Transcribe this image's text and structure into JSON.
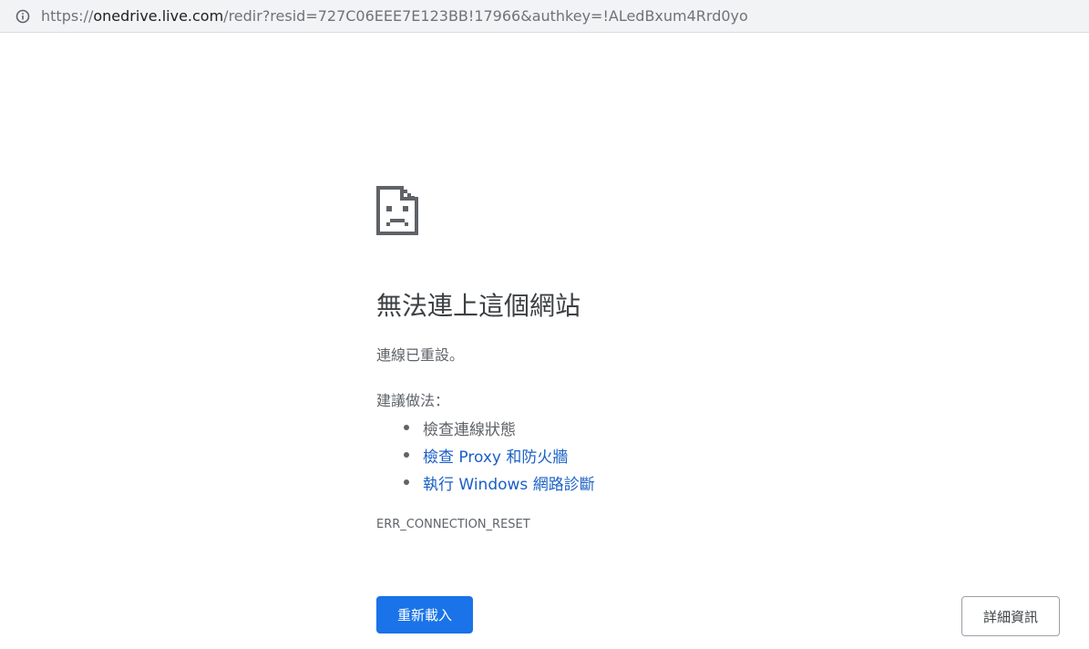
{
  "address_bar": {
    "url_scheme": "https://",
    "url_host": "onedrive.live.com",
    "url_rest": "/redir?resid=727C06EEE7E123BB!17966&authkey=!ALedBxum4Rrd0yo",
    "icon": "info-icon"
  },
  "error_page": {
    "icon": "sad-document-icon",
    "title": "無法連上這個網站",
    "subtitle": "連線已重設。",
    "suggestions_heading": "建議做法：",
    "suggestions": [
      {
        "text": "檢查連線狀態",
        "is_link": false
      },
      {
        "text": "檢查 Proxy 和防火牆",
        "is_link": true
      },
      {
        "text": "執行 Windows 網路診斷",
        "is_link": true
      }
    ],
    "error_code": "ERR_CONNECTION_RESET",
    "reload_label": "重新載入",
    "details_label": "詳細資訊"
  },
  "colors": {
    "primary_button": "#1a73e8",
    "link": "#1a5fc7",
    "text": "#5f6368"
  }
}
